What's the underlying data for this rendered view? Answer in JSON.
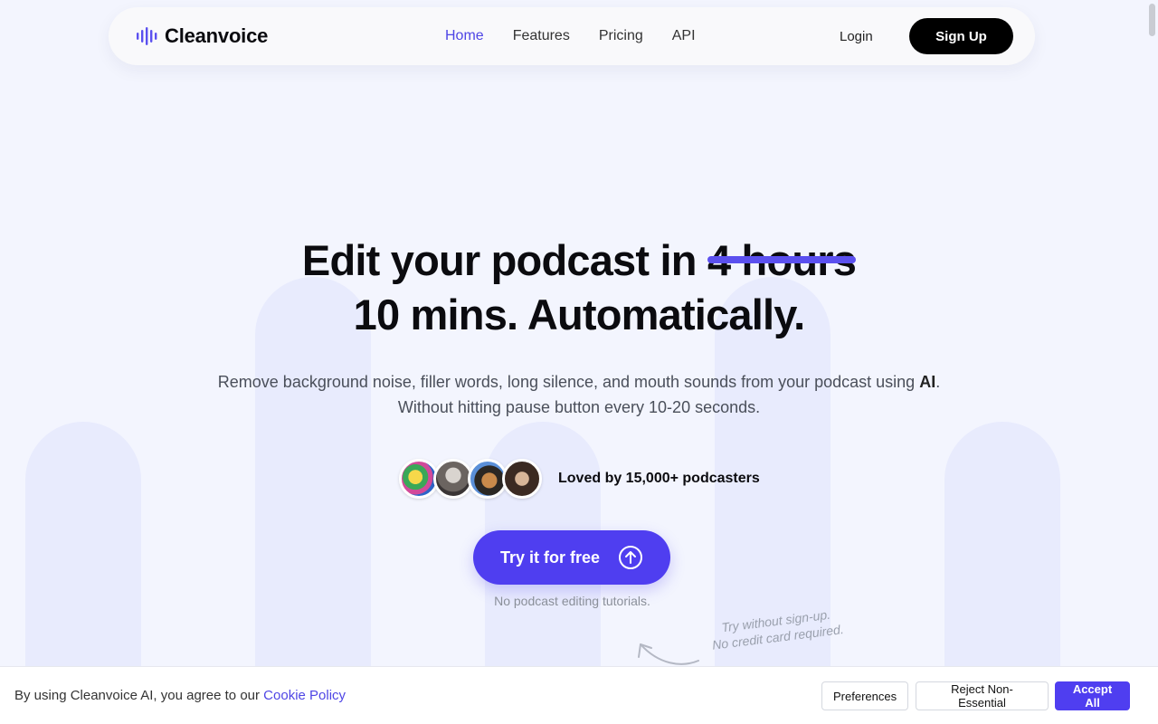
{
  "brand": {
    "name": "Cleanvoice",
    "accent": "#4f3ef0",
    "logo_icon": "waveform-icon"
  },
  "nav": {
    "links": [
      {
        "label": "Home",
        "active": true
      },
      {
        "label": "Features",
        "active": false
      },
      {
        "label": "Pricing",
        "active": false
      },
      {
        "label": "API",
        "active": false
      }
    ],
    "login_label": "Login",
    "signup_label": "Sign Up"
  },
  "hero": {
    "headline_prefix": "Edit your podcast in",
    "headline_struck": "4 hours",
    "headline_line2": "10 mins. Automatically.",
    "sub_line1_text": "Remove background noise, filler words, long silence, and mouth sounds from your podcast using ",
    "sub_line1_bold": "AI",
    "sub_line1_end": ".",
    "sub_line2": "Without hitting pause button every 10-20 seconds.",
    "social_proof": "Loved by 15,000+ podcasters",
    "cta_label": "Try it for free",
    "cta_icon": "arrow-up-circle-icon",
    "cta_note": "No podcast editing tutorials.",
    "hand_note_line1": "Try without sign-up.",
    "hand_note_line2": "No credit card required."
  },
  "cookie": {
    "text": "By using Cleanvoice AI, you agree to our ",
    "link_label": "Cookie Policy",
    "preferences_label": "Preferences",
    "reject_label": "Reject Non-Essential",
    "accept_label": "Accept All"
  }
}
